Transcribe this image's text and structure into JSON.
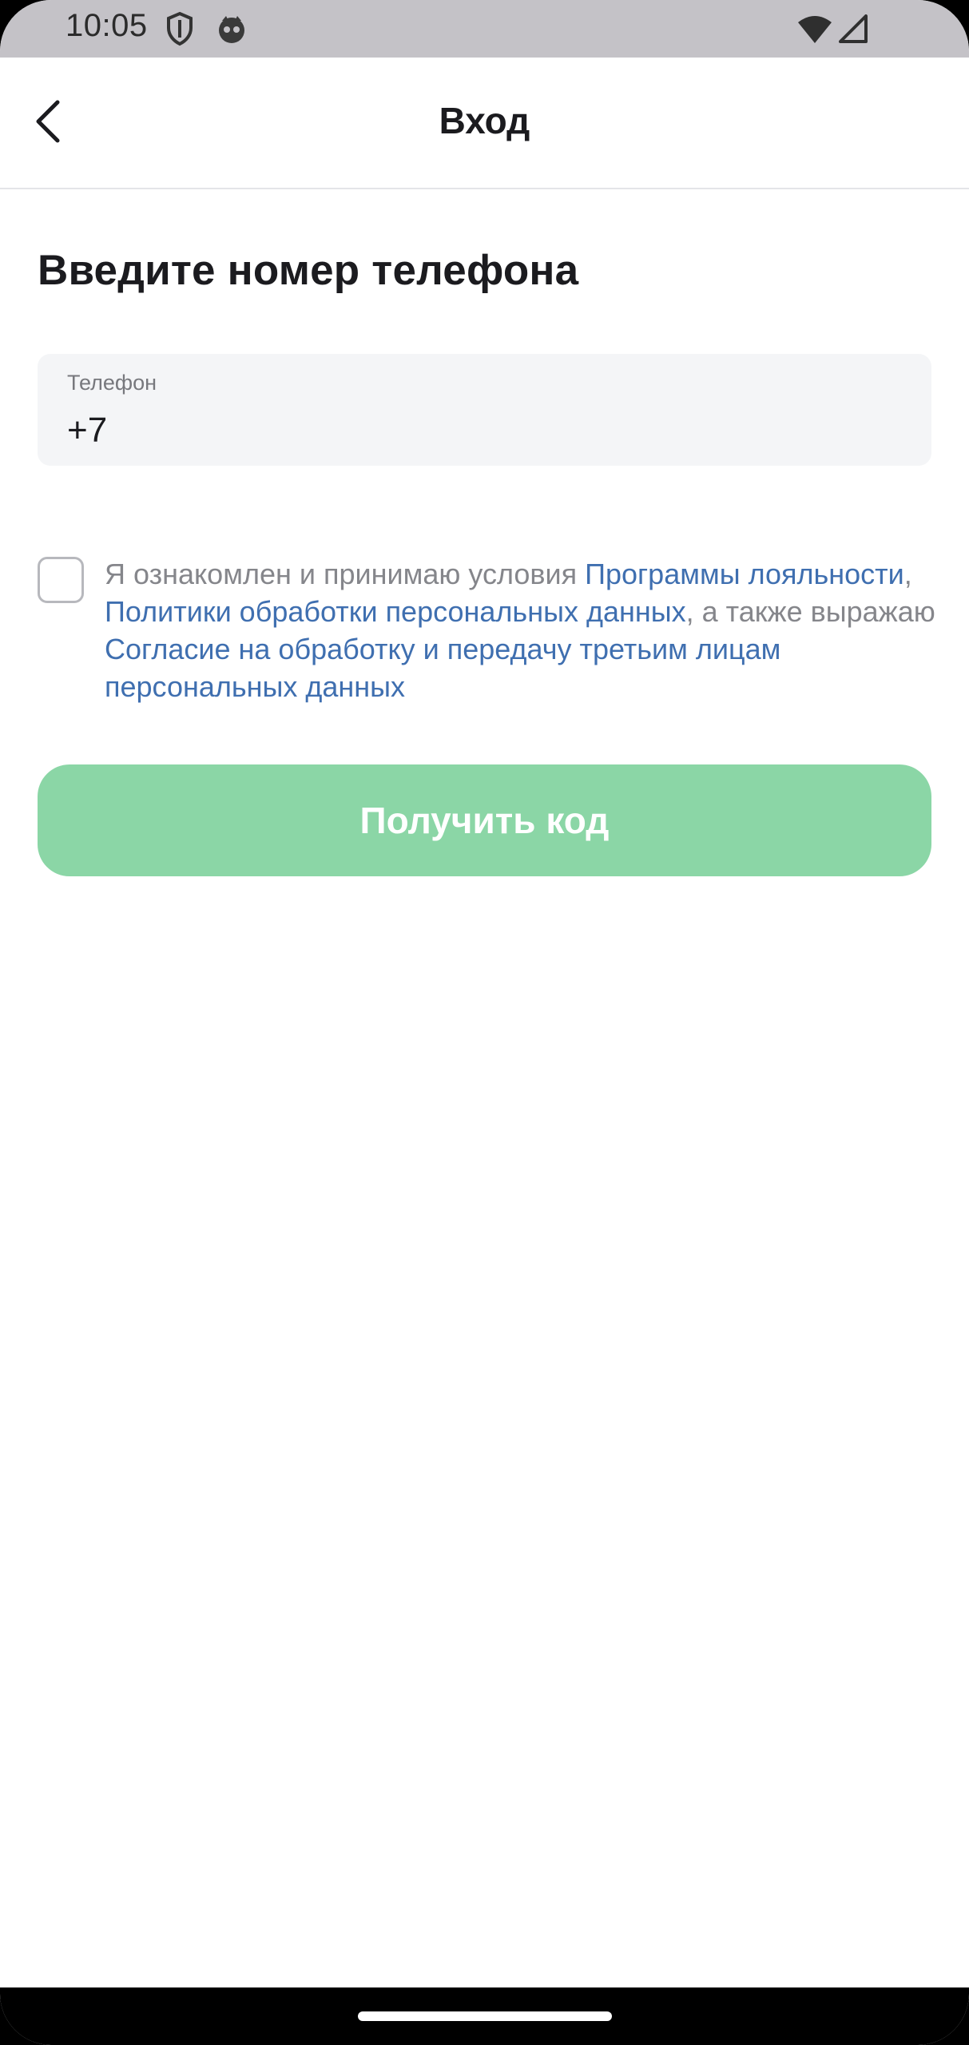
{
  "status_bar": {
    "time": "10:05",
    "icons": [
      "shield-icon",
      "app-notification-icon",
      "wifi-icon",
      "cellular-signal-icon"
    ]
  },
  "app_bar": {
    "title": "Вход",
    "back_icon": "chevron-left-icon"
  },
  "main": {
    "heading": "Введите номер телефона",
    "phone_field": {
      "label": "Телефон",
      "value": "+7"
    },
    "consent": {
      "checked": false,
      "text_1": "Я ознакомлен и принимаю условия ",
      "link_1": "Программы лояльности",
      "text_2": ", ",
      "link_2": "Политики обработки персональных данных",
      "text_3": ", а также выражаю ",
      "link_3": "Согласие на обработку и передачу третьим лицам персональных данных"
    },
    "submit_button": {
      "label": "Получить код",
      "enabled": false
    }
  },
  "colors": {
    "accent_disabled": "#8bd6a6",
    "link": "#3f6fb0",
    "text_primary": "#1b1b1f",
    "text_secondary": "#85868b",
    "field_background": "#f4f5f7"
  }
}
